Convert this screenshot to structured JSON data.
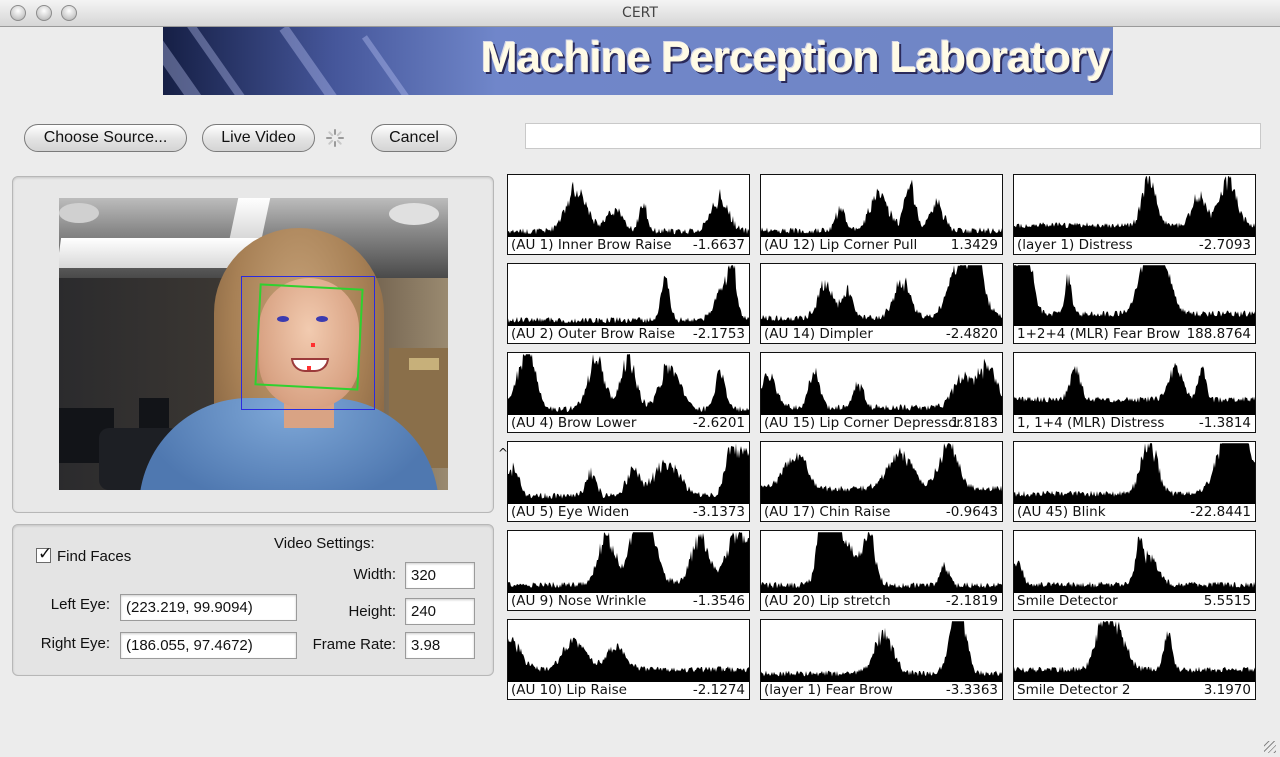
{
  "window": {
    "title": "CERT"
  },
  "banner": {
    "text": "Machine Perception Laboratory"
  },
  "toolbar": {
    "choose_source": "Choose Source...",
    "live_video": "Live Video",
    "cancel": "Cancel",
    "status_text": ""
  },
  "settings": {
    "find_faces_label": "Find Faces",
    "find_faces_checked": true,
    "video_settings_title": "Video Settings:",
    "left_eye_label": "Left Eye:",
    "left_eye_value": "(223.219, 99.9094)",
    "right_eye_label": "Right Eye:",
    "right_eye_value": "(186.055, 97.4672)",
    "width_label": "Width:",
    "width_value": "320",
    "height_label": "Height:",
    "height_value": "240",
    "frame_rate_label": "Frame Rate:",
    "frame_rate_value": "3.98"
  },
  "graphs": [
    {
      "name": "(AU 1) Inner Brow Raise",
      "value": "-1.6637"
    },
    {
      "name": "(AU 12) Lip Corner Pull",
      "value": "1.3429"
    },
    {
      "name": "(layer 1) Distress",
      "value": "-2.7093"
    },
    {
      "name": "(AU 2) Outer Brow Raise",
      "value": "-2.1753"
    },
    {
      "name": "(AU 14) Dimpler",
      "value": "-2.4820"
    },
    {
      "name": "1+2+4 (MLR) Fear Brow",
      "value": "188.8764"
    },
    {
      "name": "(AU 4) Brow Lower",
      "value": "-2.6201"
    },
    {
      "name": "(AU 15) Lip Corner Depressor",
      "value": "1.8183"
    },
    {
      "name": "1, 1+4 (MLR) Distress",
      "value": "-1.3814"
    },
    {
      "name": "(AU 5) Eye Widen",
      "value": "-3.1373"
    },
    {
      "name": "(AU 17) Chin Raise",
      "value": "-0.9643"
    },
    {
      "name": "(AU 45) Blink",
      "value": "-22.8441"
    },
    {
      "name": "(AU 9) Nose Wrinkle",
      "value": "-1.3546"
    },
    {
      "name": "(AU 20) Lip stretch",
      "value": "-2.1819"
    },
    {
      "name": "Smile Detector",
      "value": "5.5515"
    },
    {
      "name": "(AU 10) Lip Raise",
      "value": "-2.1274"
    },
    {
      "name": "(layer 1) Fear Brow",
      "value": "-3.3363"
    },
    {
      "name": "Smile Detector 2",
      "value": "3.1970"
    }
  ]
}
